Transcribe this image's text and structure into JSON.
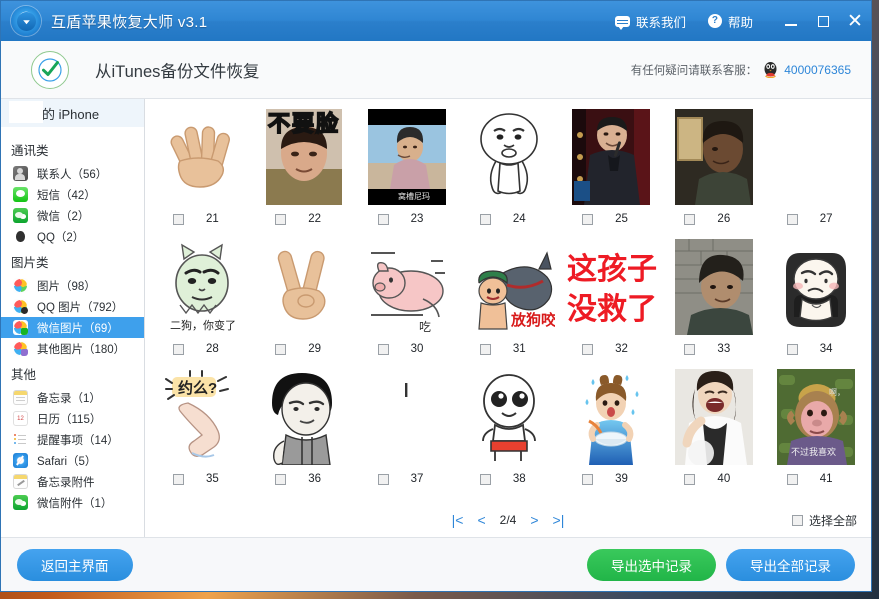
{
  "titlebar": {
    "app_title": "互盾苹果恢复大师 v3.1",
    "contact_label": "联系我们",
    "help_label": "帮助",
    "minimize": "—",
    "maximize": "□",
    "close": "✕"
  },
  "header": {
    "title": "从iTunes备份文件恢复",
    "support_text": "有任何疑问请联系客服：",
    "support_number": "4000076365"
  },
  "sidebar": {
    "device": "的 iPhone",
    "groups": [
      {
        "title": "通讯类",
        "items": [
          {
            "label": "联系人（56）",
            "icon": "contacts-icon",
            "selected": false
          },
          {
            "label": "短信（42）",
            "icon": "sms-icon",
            "selected": false
          },
          {
            "label": "微信（2）",
            "icon": "wechat-icon",
            "selected": false
          },
          {
            "label": "QQ（2）",
            "icon": "qq-icon",
            "selected": false
          }
        ]
      },
      {
        "title": "图片类",
        "items": [
          {
            "label": "图片（98）",
            "icon": "photo-icon",
            "selected": false
          },
          {
            "label": "QQ 图片（792）",
            "icon": "qq-photo-icon",
            "selected": false
          },
          {
            "label": "微信图片（69）",
            "icon": "wechat-photo-icon",
            "selected": true
          },
          {
            "label": "其他图片（180）",
            "icon": "other-photo-icon",
            "selected": false
          }
        ]
      },
      {
        "title": "其他",
        "items": [
          {
            "label": "备忘录（1）",
            "icon": "notes-icon",
            "selected": false
          },
          {
            "label": "日历（115）",
            "icon": "calendar-icon",
            "selected": false
          },
          {
            "label": "提醒事项（14）",
            "icon": "reminders-icon",
            "selected": false
          },
          {
            "label": "Safari（5）",
            "icon": "safari-icon",
            "selected": false
          },
          {
            "label": "备忘录附件",
            "icon": "note-attachment-icon",
            "selected": false
          },
          {
            "label": "微信附件（1）",
            "icon": "wechat-attachment-icon",
            "selected": false
          }
        ]
      }
    ]
  },
  "grid": {
    "items": [
      {
        "index": "21",
        "kind": "hand-open",
        "caption": "",
        "checked": false
      },
      {
        "index": "22",
        "kind": "photo-man-crying",
        "caption": "不要脸",
        "checked": false
      },
      {
        "index": "23",
        "kind": "photo-video-still",
        "caption": "窝槽尼玛",
        "checked": false
      },
      {
        "index": "24",
        "kind": "meme-fat-face",
        "caption": "",
        "checked": false
      },
      {
        "index": "25",
        "kind": "photo-comedian",
        "caption": "",
        "checked": false
      },
      {
        "index": "26",
        "kind": "photo-dark-portrait",
        "caption": "",
        "checked": false
      },
      {
        "index": "27",
        "kind": "blank",
        "caption": "",
        "checked": false
      },
      {
        "index": "28",
        "kind": "meme-green-cat",
        "caption": "二狗，你变了",
        "checked": false
      },
      {
        "index": "29",
        "kind": "hand-peace",
        "caption": "",
        "checked": false
      },
      {
        "index": "30",
        "kind": "meme-pink-pig",
        "caption": "吃",
        "checked": false
      },
      {
        "index": "31",
        "kind": "meme-dog-chase",
        "caption": "放狗咬",
        "checked": false
      },
      {
        "index": "32",
        "kind": "text-red-meme",
        "caption": "这孩子 没救了",
        "checked": false
      },
      {
        "index": "33",
        "kind": "photo-man-wall",
        "caption": "",
        "checked": false
      },
      {
        "index": "34",
        "kind": "meme-sad-blob",
        "caption": "",
        "checked": false
      },
      {
        "index": "35",
        "kind": "meme-leg-yueme",
        "caption": "约么?",
        "checked": false
      },
      {
        "index": "36",
        "kind": "meme-bowlcut-man",
        "caption": "",
        "checked": false
      },
      {
        "index": "37",
        "kind": "blank-bar",
        "caption": "",
        "checked": false
      },
      {
        "index": "38",
        "kind": "meme-white-blob",
        "caption": "",
        "checked": false
      },
      {
        "index": "39",
        "kind": "photo-girl-bowl",
        "caption": "",
        "checked": false
      },
      {
        "index": "40",
        "kind": "photo-girl-laughing",
        "caption": "",
        "checked": false
      },
      {
        "index": "41",
        "kind": "photo-monkey",
        "caption": "不过我喜欢",
        "checked": false
      }
    ]
  },
  "pager": {
    "first": "|<",
    "prev": "<",
    "position": "2/4",
    "next": ">",
    "last": ">|",
    "select_all_label": "选择全部",
    "select_all_checked": false
  },
  "footer": {
    "back_label": "返回主界面",
    "export_selected_label": "导出选中记录",
    "export_all_label": "导出全部记录"
  },
  "colors": {
    "titlebar": "#2b7fcb",
    "accent_blue": "#2e86d8",
    "selection_blue": "#3ea0ec",
    "green_button": "#21b548"
  }
}
